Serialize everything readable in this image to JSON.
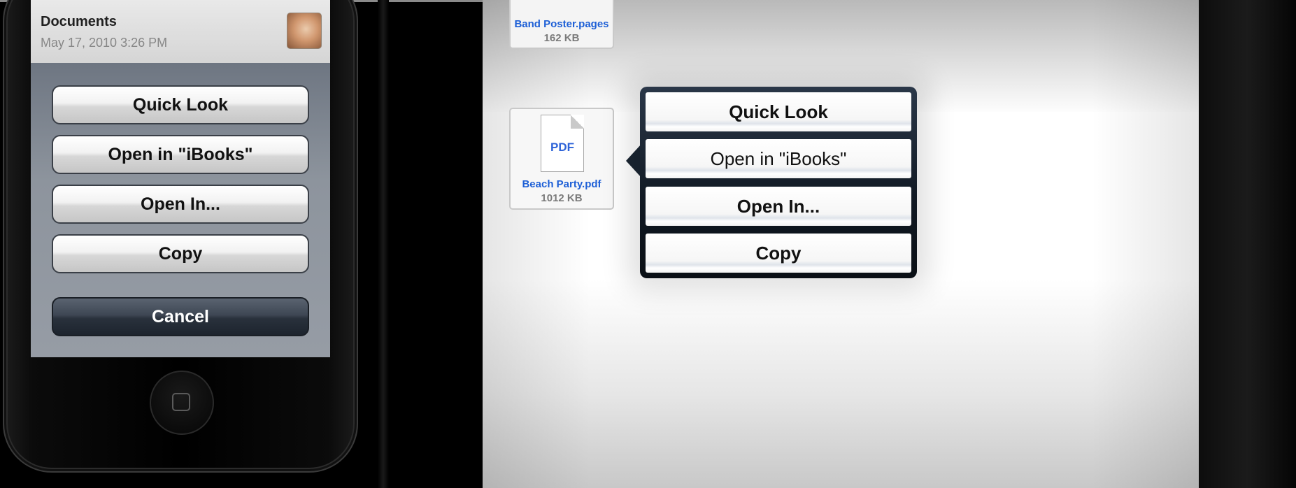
{
  "phone": {
    "document": {
      "title": "Documents",
      "date": "May 17, 2010 3:26 PM"
    },
    "actions": [
      {
        "label": "Quick Look"
      },
      {
        "label": "Open in \"iBooks\""
      },
      {
        "label": "Open In..."
      },
      {
        "label": "Copy"
      }
    ],
    "cancel_label": "Cancel"
  },
  "ipad": {
    "files": [
      {
        "name": "Band Poster.pages",
        "size": "162 KB"
      },
      {
        "name": "Beach Party.pdf",
        "size": "1012 KB",
        "badge": "PDF"
      }
    ],
    "popover_actions": [
      {
        "label": "Quick Look"
      },
      {
        "label": "Open in \"iBooks\""
      },
      {
        "label": "Open In..."
      },
      {
        "label": "Copy"
      }
    ]
  },
  "colors": {
    "file_name": "#1d5fd6",
    "popover_bg": "#111923",
    "sheet_bg": "#8d949d"
  }
}
